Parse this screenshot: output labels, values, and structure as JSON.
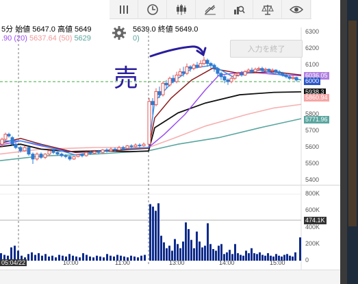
{
  "toolbar": {
    "buttons": [
      {
        "name": "bars-icon"
      },
      {
        "name": "clock-icon"
      },
      {
        "name": "candlestick-icon"
      },
      {
        "name": "draw-icon"
      },
      {
        "name": "indicator-icon"
      },
      {
        "name": "scale-icon"
      },
      {
        "name": "eye-icon"
      }
    ]
  },
  "info": {
    "interval": "5分",
    "open_label": "始値",
    "open_value": "5647.0",
    "high_label": "高値",
    "high_value": "5649",
    "close_partial": "5639.0",
    "close_label": "終値",
    "close_value": "5649.0",
    "ma1_value": ".90",
    "ma1_period": "(20)",
    "ma2_value": "5637.64",
    "ma2_period": "(50)",
    "ma3_value": "5629",
    "ma3_period": "0)"
  },
  "end_input_label": "入力を終了",
  "annotation_text": "売",
  "price_axis": [
    "6300",
    "6200",
    "6100",
    "6000",
    "5900",
    "5800",
    "5700",
    "5600",
    "5500",
    "5400"
  ],
  "price_tags": [
    {
      "label": "6036.05",
      "color": "#b07fe0"
    },
    {
      "label": "6000",
      "color": "#2a55c8"
    },
    {
      "label": "5938.3",
      "color": "#111111"
    },
    {
      "label": "5860.94",
      "color": "#f6a5a5"
    },
    {
      "label": "5771.96",
      "color": "#5aa6a0"
    }
  ],
  "volume_axis": [
    "800K",
    "600K",
    "400K",
    "200K",
    "0"
  ],
  "volume_tag": "474.1K",
  "time_axis": [
    "05:04/22",
    "10:00",
    "11:00",
    "13:00",
    "14:00",
    "15:00"
  ],
  "colors": {
    "candle_up": "#e05555",
    "candle_down": "#2e7bd1",
    "ma_short": "#3a8ee8",
    "ma_mid": "#8b1a1a",
    "ma_long": "#111111",
    "ma_purple": "#9b4df0",
    "volume": "#0b2a8a",
    "annotation": "#2a1d9c"
  },
  "chart_data": {
    "type": "candlestick",
    "ylim": [
      5400,
      6300
    ],
    "volume_ylim": [
      0,
      800000
    ]
  }
}
